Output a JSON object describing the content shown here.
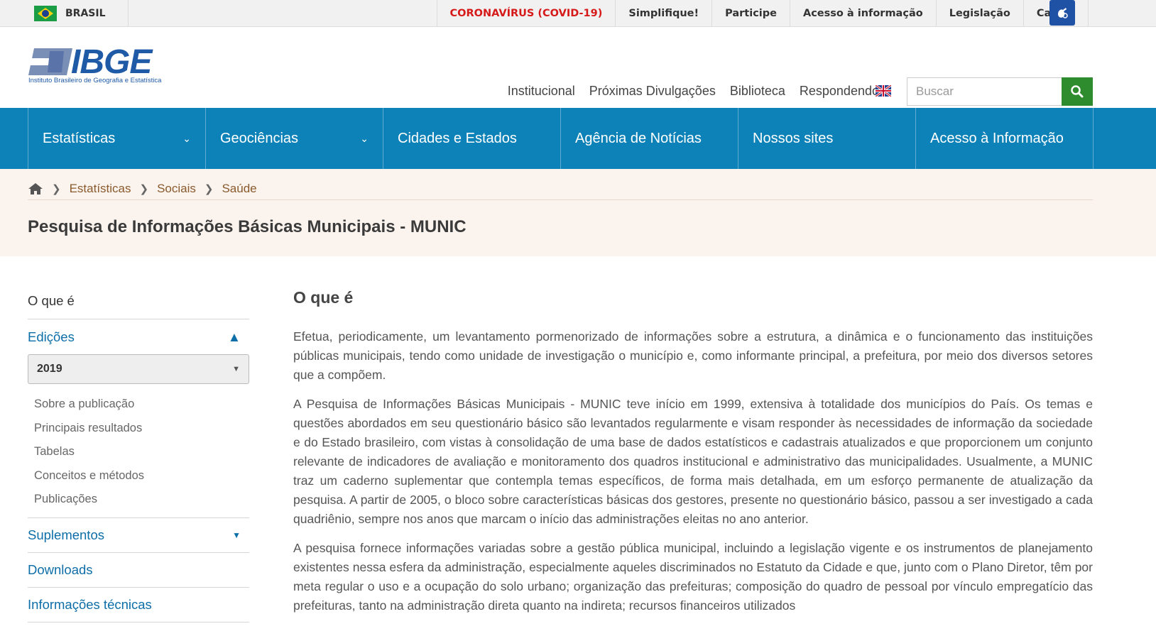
{
  "gov_bar": {
    "country": "BRASIL",
    "links": [
      "CORONAVÍRUS (COVID-19)",
      "Simplifique!",
      "Participe",
      "Acesso à informação",
      "Legislação",
      "Canais"
    ]
  },
  "logo": {
    "name": "IBGE",
    "subtitle": "Instituto Brasileiro de Geografia e Estatística"
  },
  "header": {
    "links": [
      "Institucional",
      "Próximas Divulgações",
      "Biblioteca",
      "Respondendo"
    ],
    "search_placeholder": "Buscar"
  },
  "main_nav": [
    "Estatísticas",
    "Geociências",
    "Cidades e Estados",
    "Agência de Notícias",
    "Nossos sites",
    "Acesso à Informação"
  ],
  "breadcrumb": [
    "Estatísticas",
    "Sociais",
    "Saúde"
  ],
  "page_title": "Pesquisa de Informações Básicas Municipais - MUNIC",
  "sidebar": {
    "first": "O que é",
    "editions_label": "Edições",
    "edition_selected": "2019",
    "edition_items": [
      "Sobre a publicação",
      "Principais resultados",
      "Tabelas",
      "Conceitos e métodos",
      "Publicações"
    ],
    "supplements": "Suplementos",
    "downloads": "Downloads",
    "technical": "Informações técnicas"
  },
  "content": {
    "heading": "O que é",
    "paragraphs": [
      "Efetua, periodicamente, um levantamento pormenorizado de informações sobre a estrutura, a dinâmica e o funcionamento das instituições públicas municipais, tendo como unidade de investigação o município e, como informante principal, a prefeitura, por meio dos diversos setores que a compõem.",
      "A Pesquisa de Informações Básicas Municipais - MUNIC teve início em 1999, extensiva à totalidade dos municípios do País. Os temas e questões abordados em seu questionário básico são levantados regularmente e visam responder às necessidades de informação da sociedade e do Estado brasileiro, com vistas à consolidação de uma base de dados estatísticos e cadastrais atualizados e que proporcionem um conjunto relevante de indicadores de avaliação e monitoramento dos quadros institucional e administrativo das municipalidades. Usualmente, a MUNIC traz um caderno suplementar que contempla temas específicos, de forma mais detalhada, em um esforço permanente de atualização da pesquisa. A partir de 2005, o bloco sobre características básicas dos gestores, presente no questionário básico, passou a ser investigado a cada quadriênio, sempre nos anos que marcam o início das administrações eleitas no ano anterior.",
      "A pesquisa fornece informações variadas sobre a gestão pública municipal, incluindo a legislação vigente e os instrumentos de planejamento existentes nessa esfera da administração, especialmente aqueles discriminados no Estatuto da Cidade e que, junto com o Plano Diretor, têm por meta regular o uso e a ocupação do solo urbano; organização das prefeituras; composição do quadro de pessoal por vínculo empregatício das prefeituras, tanto na administração direta quanto na indireta; recursos financeiros utilizados"
    ]
  },
  "colors": {
    "nav_blue": "#0d82b8",
    "link_blue": "#0d6ea8",
    "covid_red": "#d61a1a",
    "search_green": "#2e8b2e",
    "band_bg": "#fbf3ee"
  }
}
